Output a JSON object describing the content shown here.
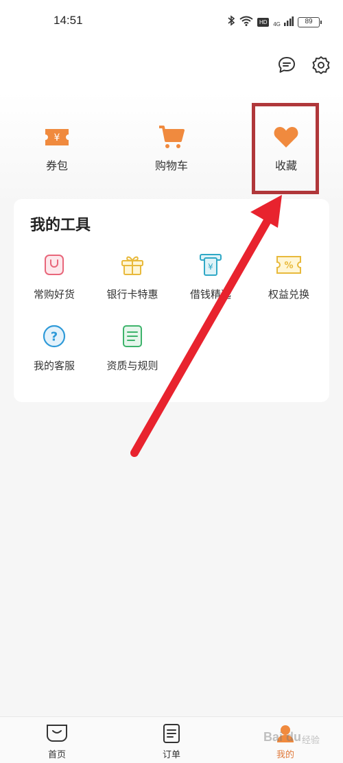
{
  "status_bar": {
    "time": "14:51",
    "network_badge": "HD",
    "signal_label": "4G",
    "battery": "89"
  },
  "header": {
    "message_icon": "chat-bubble-icon",
    "settings_icon": "gear-icon"
  },
  "quick_actions": [
    {
      "label": "券包",
      "icon": "coupon-ticket-icon"
    },
    {
      "label": "购物车",
      "icon": "shopping-cart-icon"
    },
    {
      "label": "收藏",
      "icon": "heart-icon"
    }
  ],
  "tools": {
    "title": "我的工具",
    "items": [
      {
        "label": "常购好货",
        "icon": "shopping-bag-icon"
      },
      {
        "label": "银行卡特惠",
        "icon": "gift-icon"
      },
      {
        "label": "借钱精选",
        "icon": "atm-cash-icon"
      },
      {
        "label": "权益兑换",
        "icon": "percent-ticket-icon"
      },
      {
        "label": "我的客服",
        "icon": "question-circle-icon"
      },
      {
        "label": "资质与规则",
        "icon": "document-icon"
      }
    ]
  },
  "bottom_nav": [
    {
      "label": "首页",
      "icon": "home-icon"
    },
    {
      "label": "订单",
      "icon": "order-list-icon"
    },
    {
      "label": "我的",
      "icon": "profile-icon",
      "active": true
    }
  ],
  "watermark": {
    "text": "Bai du",
    "sub": "经验"
  },
  "colors": {
    "accent_orange": "#f08a3e",
    "highlight_red": "#b0373a",
    "arrow_red": "#e8232e"
  }
}
